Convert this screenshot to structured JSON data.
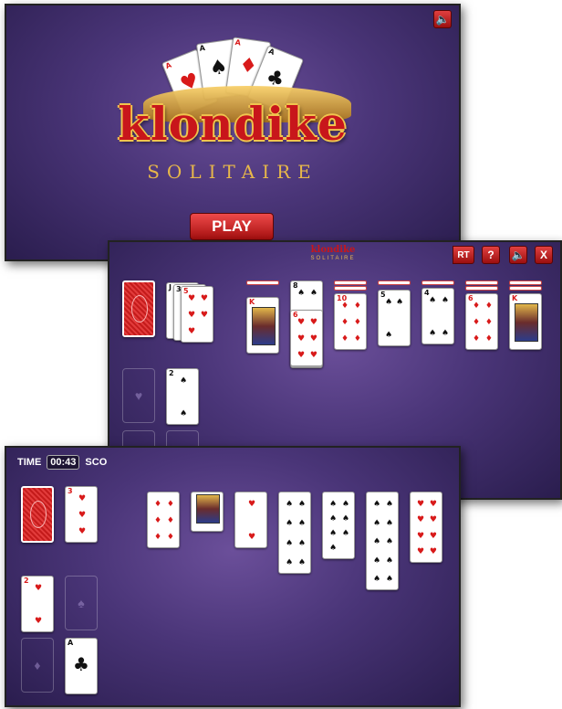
{
  "title_screen": {
    "logo_word": "klondike",
    "logo_sub": "SOLITAIRE",
    "play_label": "PLAY",
    "sound_icon": "speaker-icon"
  },
  "game_screen_1": {
    "logo_word": "klondike",
    "logo_sub": "SOLITAIRE",
    "restart_partial": "RT",
    "help_label": "?",
    "close_label": "X",
    "sound_icon": "speaker-icon"
  },
  "game_screen_2": {
    "time_label": "TIME",
    "time_value": "00:43",
    "score_partial": "SCO"
  },
  "colors": {
    "felt": "#4a3578",
    "button_red": "#c41b1b",
    "logo_gold": "#e7b74a"
  }
}
